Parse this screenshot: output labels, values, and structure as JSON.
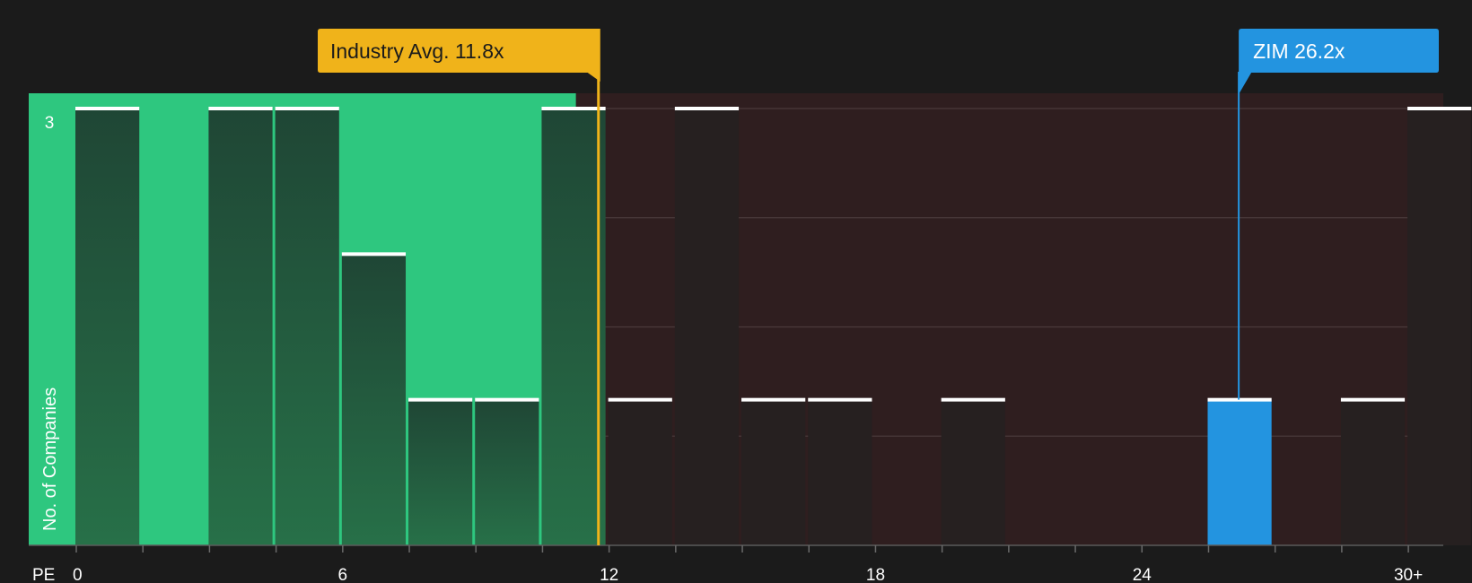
{
  "chart_data": {
    "type": "bar",
    "xlabel": "PE",
    "ylabel": "No. of Companies",
    "x_ticks": [
      "0",
      "6",
      "12",
      "18",
      "24",
      "30+"
    ],
    "y_ticks": [
      "3"
    ],
    "ylim": [
      0,
      3
    ],
    "bin_width": 1.5,
    "bins": [
      {
        "x": 0.0,
        "count": 3,
        "group": "below_avg"
      },
      {
        "x": 3.0,
        "count": 3,
        "group": "below_avg"
      },
      {
        "x": 4.5,
        "count": 3,
        "group": "below_avg"
      },
      {
        "x": 6.0,
        "count": 2,
        "group": "below_avg"
      },
      {
        "x": 7.5,
        "count": 1,
        "group": "below_avg"
      },
      {
        "x": 9.0,
        "count": 1,
        "group": "below_avg"
      },
      {
        "x": 10.5,
        "count": 3,
        "group": "below_avg"
      },
      {
        "x": 12.0,
        "count": 1,
        "group": "above_avg"
      },
      {
        "x": 13.5,
        "count": 3,
        "group": "above_avg"
      },
      {
        "x": 15.0,
        "count": 1,
        "group": "above_avg"
      },
      {
        "x": 16.5,
        "count": 1,
        "group": "above_avg"
      },
      {
        "x": 19.5,
        "count": 1,
        "group": "above_avg"
      },
      {
        "x": 25.5,
        "count": 1,
        "group": "highlight"
      },
      {
        "x": 28.5,
        "count": 1,
        "group": "above_avg"
      },
      {
        "x": 30.0,
        "count": 3,
        "group": "above_avg"
      }
    ],
    "industry_avg": {
      "label": "Industry Avg. 11.8x",
      "value": 11.8
    },
    "company": {
      "label": "ZIM 26.2x",
      "value": 26.2
    },
    "grid": true,
    "colors": {
      "background": "#1b1b1b",
      "below_avg_region": "#2ec77f",
      "above_avg_region": "#2f1e1f",
      "bar_dark": "#1f4a35",
      "bar_dark_bottom": "#26704a",
      "bar_neutral": "#262020",
      "highlight": "#2394e0",
      "industry_avg": "#f0b31a",
      "bar_cap": "#ffffff",
      "grid": "#4a3a3b"
    }
  }
}
